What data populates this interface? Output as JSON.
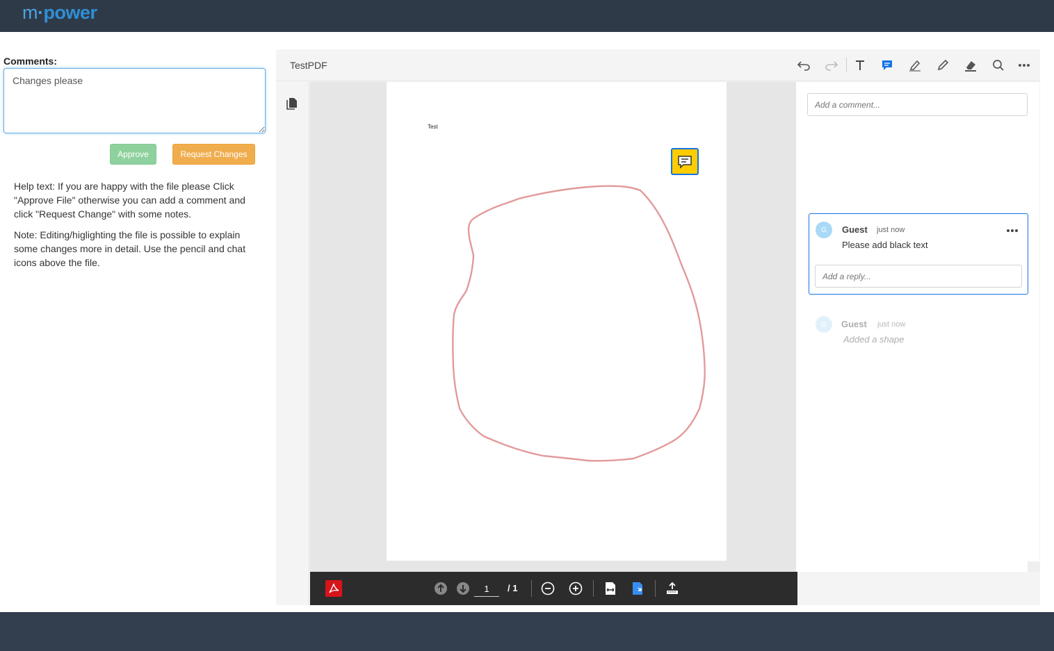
{
  "brand": {
    "logo_m": "m",
    "logo_dot": "·",
    "logo_rest": "power"
  },
  "form": {
    "label": "Comments:",
    "value": "Changes please",
    "approve_label": "Approve",
    "request_label": "Request Changes",
    "help_text": "Help text: If you are happy with the file please Click \"Approve File\" otherwise you can add a comment and click \"Request Change\" with some notes.",
    "note_text": "Note: Editing/higlighting the file is possible to explain some changes more in detail. Use the pencil and chat icons above the file."
  },
  "viewer": {
    "file_name": "TestPDF",
    "toolbar_icons": [
      "undo-icon",
      "redo-icon",
      "text-icon",
      "comment-icon",
      "highlight-icon",
      "pencil-icon",
      "eraser-icon",
      "search-icon",
      "more-icon"
    ],
    "page_text": "Test",
    "current_page": "1",
    "total_pages": "/ 1"
  },
  "comments": {
    "placeholder": "Add a comment...",
    "items": [
      {
        "initial": "G",
        "author": "Guest",
        "time": "just now",
        "text": "Please add black text",
        "reply_placeholder": "Add a reply..."
      },
      {
        "initial": "G",
        "author": "Guest",
        "time": "just now",
        "text": "Added a shape"
      }
    ]
  },
  "colors": {
    "header": "#2f3a49",
    "accent": "#1473e6",
    "approve": "#8fd19e",
    "request": "#f0ad4e",
    "shape_stroke": "#e29a9a",
    "note": "#ffcc00"
  }
}
